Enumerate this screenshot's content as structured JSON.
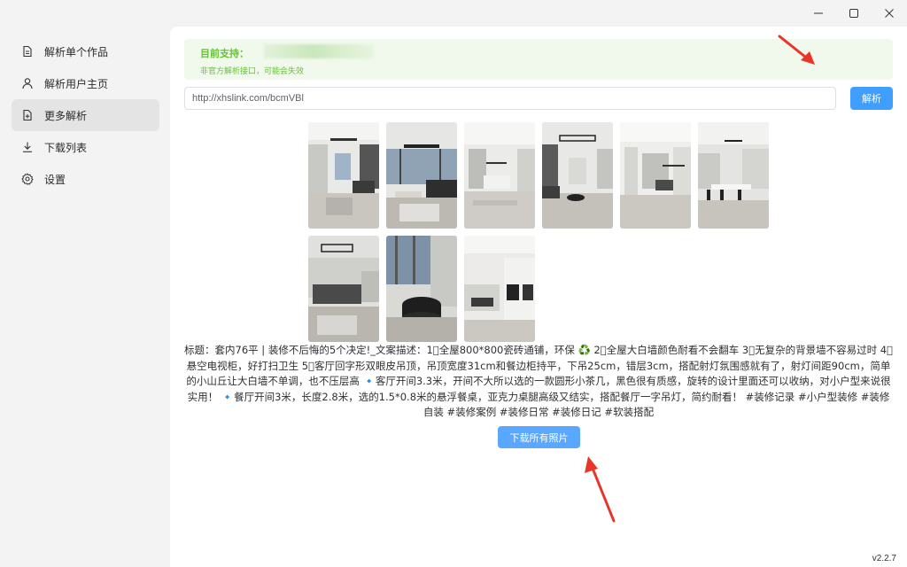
{
  "window": {
    "controls": {
      "minimize": "minimize-icon",
      "maximize": "maximize-icon",
      "close": "close-icon"
    }
  },
  "sidebar": {
    "items": [
      {
        "label": "解析单个作品",
        "icon": "document-icon",
        "active": false
      },
      {
        "label": "解析用户主页",
        "icon": "user-icon",
        "active": false
      },
      {
        "label": "更多解析",
        "icon": "document-plus-icon",
        "active": true
      },
      {
        "label": "下载列表",
        "icon": "download-icon",
        "active": false
      },
      {
        "label": "设置",
        "icon": "gear-icon",
        "active": false
      }
    ]
  },
  "notice": {
    "title": "目前支持：",
    "description": "非官方解析接口，可能会失效"
  },
  "url_input": {
    "value": "http://xhslink.com/bcmVBl"
  },
  "parse_button": {
    "label": "解析"
  },
  "images": {
    "count": 9
  },
  "description": "标题：套内76平 | 装修不后悔的5个决定!_文案描述：1⃣全屋800*800瓷砖通铺，环保 ♻️ 2⃣全屋大白墙颜色耐看不会翻车 3⃣无复杂的背景墙不容易过时 4⃣悬空电视柜，好打扫卫生 5⃣客厅回字形双眼皮吊顶，吊顶宽度31cm和餐边柜持平，下吊25cm，错层3cm，搭配射灯氛围感就有了，射灯间距90cm，简单的小山丘让大白墙不单调，也不压层高 🔹客厅开间3.3米，开间不大所以选的一款圆形小茶几，黑色很有质感，旋转的设计里面还可以收纳，对小户型来说很实用！ 🔹餐厅开间3米，长度2.8米，选的1.5*0.8米的悬浮餐桌，亚克力桌腿高级又结实，搭配餐厅一字吊灯，简约耐看！ #装修记录 #小户型装修 #装修自装 #装修案例 #装修日常 #装修日记 #软装搭配",
  "download_button": {
    "label": "下载所有照片"
  },
  "version": "v2.2.7",
  "colors": {
    "primary": "#409eff",
    "success_bg": "#f0f9eb",
    "success_text": "#67c23a",
    "annotation_arrow": "#e8352a"
  }
}
